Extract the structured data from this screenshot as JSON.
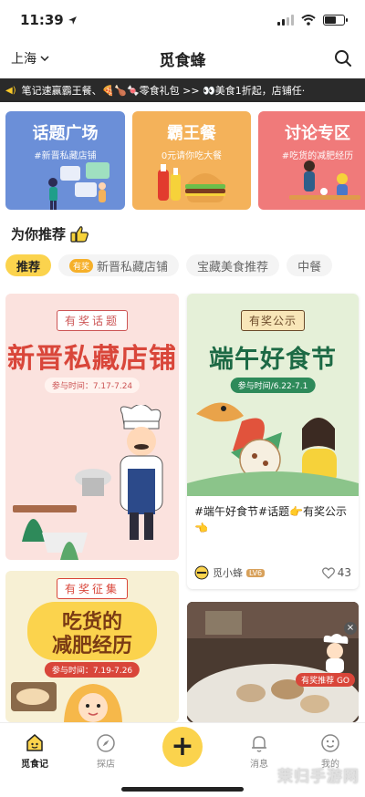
{
  "status": {
    "time": "11:39"
  },
  "header": {
    "city": "上海",
    "title": "觅食蜂"
  },
  "ticker": {
    "text": "笔记速赢霸王餐、🍕🍗🍬零食礼包 >>  👀美食1折起，店铺任·"
  },
  "topics": [
    {
      "title": "话题广场",
      "subtitle": "#新晋私藏店铺"
    },
    {
      "title": "霸王餐",
      "subtitle": "0元请你吃大餐"
    },
    {
      "title": "讨论专区",
      "subtitle": "#吃货的减肥经历"
    }
  ],
  "recommend": {
    "title": "为你推荐"
  },
  "chips": [
    {
      "label": "推荐"
    },
    {
      "badge": "有奖",
      "label": "新晋私藏店铺"
    },
    {
      "label": "宝藏美食推荐"
    },
    {
      "label": "中餐"
    }
  ],
  "feed": {
    "card1": {
      "badge": "有奖话题",
      "title": "新晋私藏店铺",
      "time": "参与时间：7.17-7.24"
    },
    "card2": {
      "badge": "有奖公示",
      "title": "端午好食节",
      "time": "参与时间/6.22-7.1",
      "text": "#端午好食节#话题👉有奖公示👈",
      "author": "觅小蜂",
      "level": "LV6",
      "likes": "43"
    },
    "card3": {
      "badge": "有奖征集",
      "title1": "吃货的",
      "title2": "减肥经历",
      "time": "参与时间：7.19-7.26"
    },
    "card4": {
      "tag": "有奖推荐 GO"
    }
  },
  "nav": [
    {
      "label": "觅食记"
    },
    {
      "label": "探店"
    },
    {
      "label": "消息"
    },
    {
      "label": "我的"
    }
  ],
  "watermark": "茉归手游网",
  "colors": {
    "accent": "#fbd34d",
    "topic1": "#6b8fd8",
    "topic2": "#f4b25a",
    "topic3": "#f07a7a"
  }
}
